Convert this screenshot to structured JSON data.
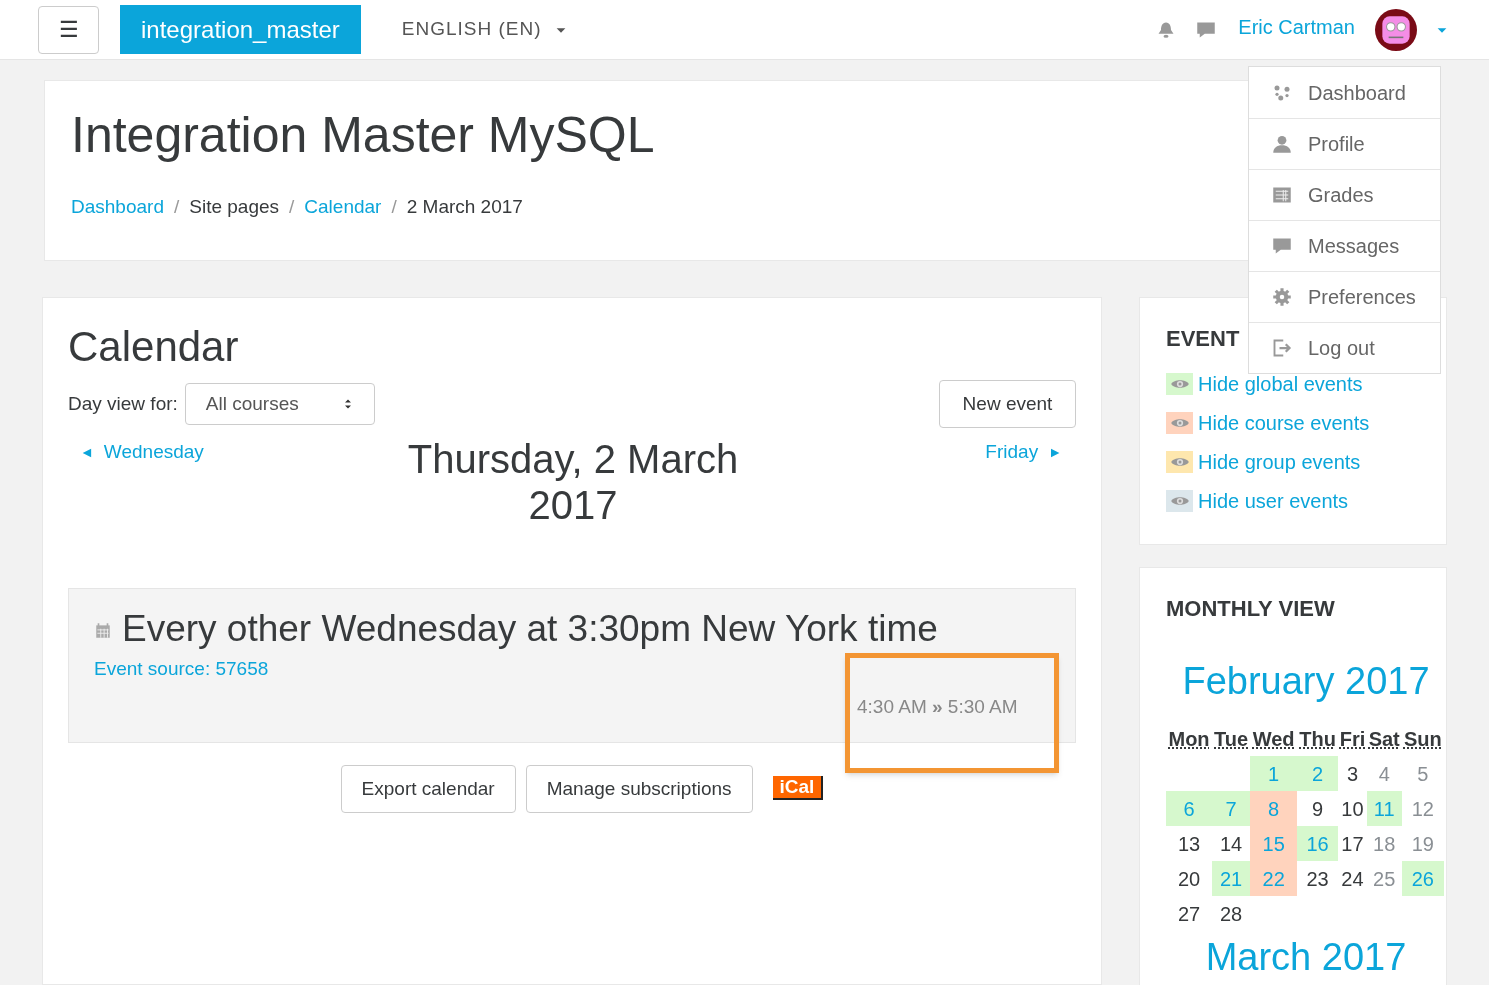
{
  "navbar": {
    "menu_button": "☰",
    "site_name": "integration_master",
    "language": "ENGLISH (EN)",
    "user_name": "Eric Cartman"
  },
  "user_menu": {
    "items": [
      {
        "kind": "dashboard",
        "label": "Dashboard"
      },
      {
        "kind": "profile",
        "label": "Profile"
      },
      {
        "kind": "grades",
        "label": "Grades"
      },
      {
        "kind": "messages",
        "label": "Messages"
      },
      {
        "kind": "preferences",
        "label": "Preferences"
      },
      {
        "kind": "logout",
        "label": "Log out"
      }
    ]
  },
  "page_header": {
    "title": "Integration Master MySQL",
    "breadcrumbs": [
      {
        "kind": "link",
        "label": "Dashboard"
      },
      {
        "kind": "separator",
        "label": "/"
      },
      {
        "kind": "text",
        "label": "Site pages"
      },
      {
        "kind": "separator",
        "label": "/"
      },
      {
        "kind": "link",
        "label": "Calendar"
      },
      {
        "kind": "separator",
        "label": "/"
      },
      {
        "kind": "text",
        "label": "2 March 2017"
      }
    ]
  },
  "calendar": {
    "heading": "Calendar",
    "day_view_label": "Day view for:",
    "course_select": "All courses",
    "new_event_button": "New event",
    "prev_day": "Wednesday",
    "next_day": "Friday",
    "prev_arrow": "◄",
    "next_arrow": "►",
    "day_title": "Thursday, 2 March 2017",
    "event": {
      "title": "Every other Wednesday at 3:30pm New York time",
      "source": "Event source: 57658",
      "time": "4:30 AM **»** 5:30 AM",
      "highlighted": true
    },
    "buttons": [
      "Export calendar",
      "Manage subscriptions"
    ],
    "ical": "iCal"
  },
  "events_block": {
    "title": "EVENT",
    "items": [
      {
        "label": "Hide global events",
        "color": "#d6f8cd"
      },
      {
        "label": "Hide course events",
        "color": "#ffd3bd"
      },
      {
        "label": "Hide group events",
        "color": "#fee7ae"
      },
      {
        "label": "Hide user events",
        "color": "#dce7ec"
      }
    ]
  },
  "monthly_view": {
    "title": "MONTHLY VIEW",
    "month": "February 2017",
    "weekdays": [
      "Mon",
      "Tue",
      "Wed",
      "Thu",
      "Fri",
      "Sat",
      "Sun"
    ],
    "weeks": [
      [
        {
          "kind": "blank"
        },
        {
          "kind": "blank"
        },
        {
          "kind": "event",
          "day": "1",
          "color": "#d6f8cd"
        },
        {
          "kind": "event",
          "day": "2",
          "color": "#d6f8cd"
        },
        {
          "kind": "plain",
          "day": "3"
        },
        {
          "kind": "weekend",
          "day": "4"
        },
        {
          "kind": "weekend",
          "day": "5"
        }
      ],
      [
        {
          "kind": "event",
          "day": "6",
          "color": "#d6f8cd"
        },
        {
          "kind": "event",
          "day": "7",
          "color": "#d6f8cd"
        },
        {
          "kind": "event",
          "day": "8",
          "color": "#ffd3bd"
        },
        {
          "kind": "plain",
          "day": "9"
        },
        {
          "kind": "plain",
          "day": "10"
        },
        {
          "kind": "event",
          "day": "11",
          "color": "#d6f8cd"
        },
        {
          "kind": "weekend",
          "day": "12"
        }
      ],
      [
        {
          "kind": "plain",
          "day": "13"
        },
        {
          "kind": "plain",
          "day": "14"
        },
        {
          "kind": "event",
          "day": "15",
          "color": "#ffd3bd"
        },
        {
          "kind": "event",
          "day": "16",
          "color": "#d6f8cd"
        },
        {
          "kind": "plain",
          "day": "17"
        },
        {
          "kind": "weekend",
          "day": "18"
        },
        {
          "kind": "weekend",
          "day": "19"
        }
      ],
      [
        {
          "kind": "plain",
          "day": "20"
        },
        {
          "kind": "event",
          "day": "21",
          "color": "#d6f8cd"
        },
        {
          "kind": "event",
          "day": "22",
          "color": "#ffd3bd"
        },
        {
          "kind": "plain",
          "day": "23"
        },
        {
          "kind": "plain",
          "day": "24"
        },
        {
          "kind": "weekend",
          "day": "25"
        },
        {
          "kind": "event",
          "day": "26",
          "color": "#d6f8cd"
        }
      ],
      [
        {
          "kind": "plain",
          "day": "27"
        },
        {
          "kind": "plain",
          "day": "28"
        }
      ]
    ],
    "next_month": "March 2017"
  }
}
